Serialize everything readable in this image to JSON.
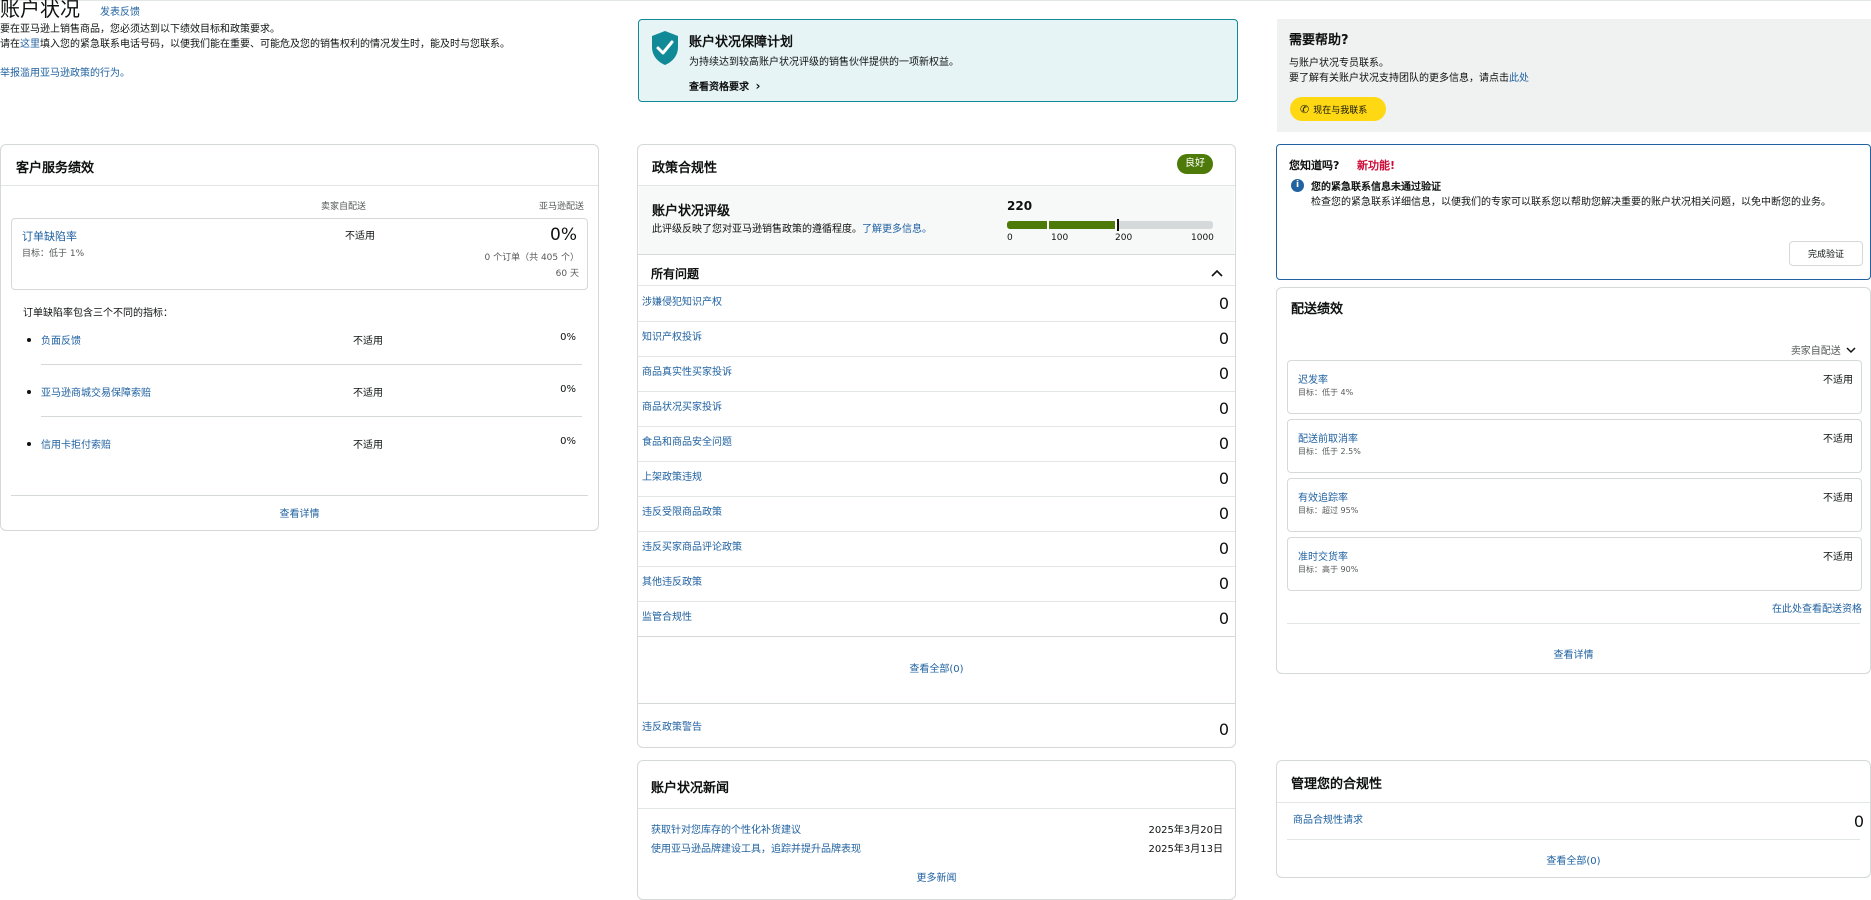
{
  "header": {
    "title": "账户状况",
    "feedback": "发表反馈",
    "line1": "要在亚马逊上销售商品，您必须达到以下绩效目标和政策要求。",
    "line2_pre": "请在",
    "line2_link": "这里",
    "line2_post": "填入您的紧急联系电话号码，以便我们能在重要、可能危及您的销售权利的情况发生时，能及时与您联系。",
    "report_link": "举报滥用亚马逊政策的行为。"
  },
  "protection": {
    "title": "账户状况保障计划",
    "desc": "为持续达到较高账户状况评级的销售伙伴提供的一项新权益。",
    "link": "查看资格要求"
  },
  "help": {
    "title": "需要帮助?",
    "line1": "与账户状况专员联系。",
    "line2_pre": "要了解有关账户状况支持团队的更多信息，请点击",
    "line2_link": "此处",
    "button": "现在与我联系"
  },
  "customer_service": {
    "title": "客户服务绩效",
    "col1": "卖家自配送",
    "col2": "亚马逊配送",
    "odr_label": "订单缺陷率",
    "odr_target": "目标：低于 1%",
    "odr_mfn": "不适用",
    "odr_afn": "0%",
    "odr_orders": "0 个订单（共 405 个）",
    "odr_days": "60 天",
    "intro": "订单缺陷率包含三个不同的指标：",
    "metrics": [
      {
        "label": "负面反馈",
        "mfn": "不适用",
        "afn": "0%"
      },
      {
        "label": "亚马逊商城交易保障索赔",
        "mfn": "不适用",
        "afn": "0%"
      },
      {
        "label": "信用卡拒付索赔",
        "mfn": "不适用",
        "afn": "0%"
      }
    ],
    "details": "查看详情"
  },
  "policy": {
    "title": "政策合规性",
    "badge": "良好",
    "ahr_title": "账户状况评级",
    "ahr_desc": "此评级反映了您对亚马逊销售政策的遵循程度。",
    "ahr_link": "了解更多信息。",
    "ahr_score": "220",
    "ahr_value": 220,
    "ahr_max": 1000,
    "ticks": [
      "0",
      "100",
      "200",
      "1000"
    ],
    "issues_title": "所有问题",
    "issues": [
      {
        "label": "涉嫌侵犯知识产权",
        "value": "0"
      },
      {
        "label": "知识产权投诉",
        "value": "0"
      },
      {
        "label": "商品真实性买家投诉",
        "value": "0"
      },
      {
        "label": "商品状况买家投诉",
        "value": "0"
      },
      {
        "label": "食品和商品安全问题",
        "value": "0"
      },
      {
        "label": "上架政策违规",
        "value": "0"
      },
      {
        "label": "违反受限商品政策",
        "value": "0"
      },
      {
        "label": "违反买家商品评论政策",
        "value": "0"
      },
      {
        "label": "其他违反政策",
        "value": "0"
      },
      {
        "label": "监管合规性",
        "value": "0"
      }
    ],
    "view_all": "查看全部(0)",
    "warnings_label": "违反政策警告",
    "warnings_value": "0"
  },
  "did_you_know": {
    "title": "您知道吗?",
    "new": "新功能!",
    "headline": "您的紧急联系信息未通过验证",
    "body": "检查您的紧急联系详细信息，以便我们的专家可以联系您以帮助您解决重要的账户状况相关问题，以免中断您的业务。",
    "button": "完成验证"
  },
  "shipping": {
    "title": "配送绩效",
    "filter": "卖家自配送",
    "tiles": [
      {
        "label": "迟发率",
        "target": "目标：低于 4%",
        "value": "不适用"
      },
      {
        "label": "配送前取消率",
        "target": "目标：低于 2.5%",
        "value": "不适用"
      },
      {
        "label": "有效追踪率",
        "target": "目标：超过 95%",
        "value": "不适用"
      },
      {
        "label": "准时交货率",
        "target": "目标：高于 90%",
        "value": "不适用"
      }
    ],
    "eligibility": "在此处查看配送资格",
    "details": "查看详情"
  },
  "news": {
    "title": "账户状况新闻",
    "items": [
      {
        "label": "获取针对您库存的个性化补货建议",
        "date": "2025年3月20日"
      },
      {
        "label": "使用亚马逊品牌建设工具，追踪并提升品牌表现",
        "date": "2025年3月13日"
      }
    ],
    "more": "更多新闻"
  },
  "manage": {
    "title": "管理您的合规性",
    "item_label": "商品合规性请求",
    "item_value": "0",
    "view_all": "查看全部(0)"
  },
  "colors": {
    "link": "#2162a1",
    "good": "#4e7a0a",
    "yellow": "#ffd814",
    "teal_bg": "#e7f4f5",
    "teal_border": "#0f8a96"
  }
}
